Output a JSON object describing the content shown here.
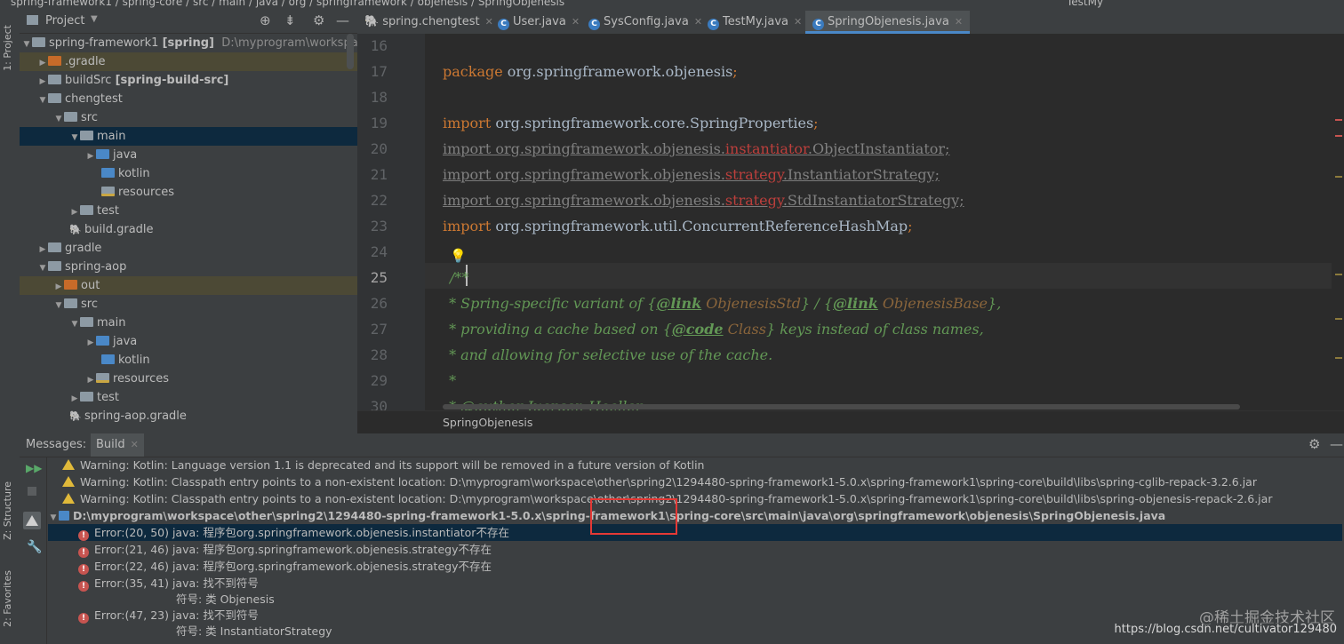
{
  "topbar": {
    "breadcrumb": "spring-framework1 / spring-core / src / main / java / org / springframework / objenesis / SpringObjenesis",
    "run_config": "TestMy"
  },
  "left_stripe": {
    "project_label": "1: Project",
    "structure_label": "Z: Structure",
    "favorites_label": "2: Favorites"
  },
  "project": {
    "title": "Project",
    "items": [
      {
        "label": "spring-framework1",
        "tag": "[spring]",
        "path": "D:\\myprogram\\workspace\\ot"
      },
      {
        "label": ".gradle"
      },
      {
        "label": "buildSrc",
        "tag": "[spring-build-src]"
      },
      {
        "label": "chengtest"
      },
      {
        "label": "src"
      },
      {
        "label": "main"
      },
      {
        "label": "java"
      },
      {
        "label": "kotlin"
      },
      {
        "label": "resources"
      },
      {
        "label": "test"
      },
      {
        "label": "build.gradle"
      },
      {
        "label": "gradle"
      },
      {
        "label": "spring-aop"
      },
      {
        "label": "out"
      },
      {
        "label": "src"
      },
      {
        "label": "main"
      },
      {
        "label": "java"
      },
      {
        "label": "kotlin"
      },
      {
        "label": "resources"
      },
      {
        "label": "test"
      },
      {
        "label": "spring-aop.gradle"
      }
    ]
  },
  "tabs": [
    {
      "label": "spring.chengtest"
    },
    {
      "label": "User.java"
    },
    {
      "label": "SysConfig.java"
    },
    {
      "label": "TestMy.java"
    },
    {
      "label": "SpringObjenesis.java"
    }
  ],
  "editor": {
    "line_numbers": [
      "16",
      "17",
      "18",
      "19",
      "20",
      "21",
      "22",
      "23",
      "24",
      "25",
      "26",
      "27",
      "28",
      "29",
      "30"
    ],
    "l17_kw": "package",
    "l17_rest": " org.springframework.objenesis",
    "l19_kw": "import",
    "l19_rest": " org.springframework.core.SpringProperties",
    "l20_pre": "import org.springframework.objenesis.",
    "l20_bad": "instantiator",
    "l20_post": ".ObjectInstantiator;",
    "l21_pre": "import org.springframework.objenesis.",
    "l21_bad": "strategy",
    "l21_post": ".InstantiatorStrategy;",
    "l22_pre": "import org.springframework.objenesis.",
    "l22_bad": "strategy",
    "l22_post": ".StdInstantiatorStrategy;",
    "l23_kw": "import",
    "l23_rest": " org.springframework.util.ConcurrentReferenceHashMap",
    "semicolon": ";",
    "l25": "/**",
    "l26_a": " * Spring-specific variant of {",
    "l26_tag1": "@link",
    "l26_ref1": " ObjenesisStd",
    "l26_b": "} / {",
    "l26_tag2": "@link",
    "l26_ref2": " ObjenesisBase",
    "l26_c": "},",
    "l27_a": " * providing a cache based on {",
    "l27_tag": "@code",
    "l27_ref": " Class",
    "l27_b": "} keys instead of class names,",
    "l28": " * and allowing for selective use of the cache.",
    "l29": " *",
    "l30": " * @author Juergen Hoeller",
    "breadcrumb": "SpringObjenesis"
  },
  "messages": {
    "tab_messages": "Messages:",
    "tab_build": "Build",
    "rows": [
      {
        "type": "warning",
        "text": "Warning: Kotlin: Language version 1.1 is deprecated and its support will be removed in a future version of Kotlin"
      },
      {
        "type": "warning",
        "text": "Warning: Kotlin: Classpath entry points to a non-existent location: D:\\myprogram\\workspace\\other\\spring2\\1294480-spring-framework1-5.0.x\\spring-framework1\\spring-core\\build\\libs\\spring-cglib-repack-3.2.6.jar"
      },
      {
        "type": "warning",
        "text": "Warning: Kotlin: Classpath entry points to a non-existent location: D:\\myprogram\\workspace\\other\\spring2\\1294480-spring-framework1-5.0.x\\spring-framework1\\spring-core\\build\\libs\\spring-objenesis-repack-2.6.jar"
      },
      {
        "type": "file",
        "text": "D:\\myprogram\\workspace\\other\\spring2\\1294480-spring-framework1-5.0.x\\spring-framework1\\spring-core\\src\\main\\java\\org\\springframework\\objenesis\\SpringObjenesis.java"
      },
      {
        "type": "error",
        "text": "Error:(20, 50)  java: 程序包org.springframework.objenesis.instantiator不存在"
      },
      {
        "type": "error",
        "text": "Error:(21, 46)  java: 程序包org.springframework.objenesis.strategy不存在"
      },
      {
        "type": "error",
        "text": "Error:(22, 46)  java: 程序包org.springframework.objenesis.strategy不存在"
      },
      {
        "type": "error",
        "text": "Error:(35, 41)  java: 找不到符号"
      },
      {
        "type": "detail",
        "text": "符号: 类 Objenesis"
      },
      {
        "type": "error",
        "text": "Error:(47, 23)  java: 找不到符号"
      },
      {
        "type": "detail",
        "text": "符号:  类 InstantiatorStrategy"
      }
    ]
  },
  "watermark": {
    "line1": "@稀土掘金技术社区",
    "line2": "https://blog.csdn.net/cultivator129480"
  },
  "colors": {
    "accent": "#4a88c7",
    "error": "#c75450",
    "warning": "#e0b93a",
    "highlight_box": "#e53935"
  }
}
